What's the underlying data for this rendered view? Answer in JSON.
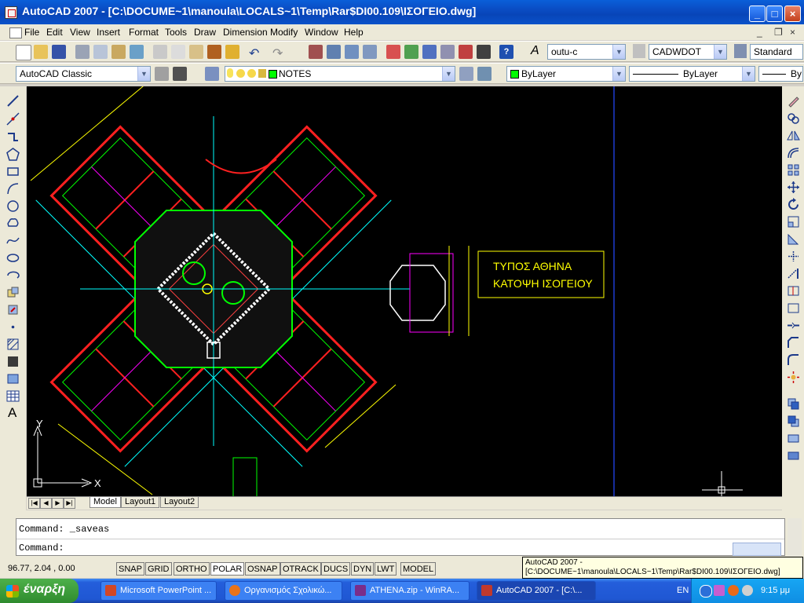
{
  "window": {
    "title": "AutoCAD 2007 - [C:\\DOCUME~1\\manoula\\LOCALS~1\\Temp\\Rar$DI00.109\\ΙΣΟΓΕΙΟ.dwg]",
    "min_glyph": "_",
    "max_glyph": "□",
    "close_glyph": "×"
  },
  "menu": [
    "File",
    "Edit",
    "View",
    "Insert",
    "Format",
    "Tools",
    "Draw",
    "Dimension",
    "Modify",
    "Window",
    "Help"
  ],
  "toolbar": {
    "text_style": "outu-c",
    "dim_style": "CADWDOT",
    "table_style": "Standard",
    "workspace": "AutoCAD Classic",
    "layer": "NOTES",
    "color": "ByLayer",
    "linetype": "ByLayer",
    "lineweight": "By"
  },
  "drawing": {
    "label_line1": "ΤΥΠΟΣ ΑΘΗΝΑ",
    "label_line2": "ΚΑΤΟΨΗ ΙΣΟΓΕΙΟΥ",
    "ucs_x": "X",
    "ucs_y": "Y"
  },
  "tabs": [
    "Model",
    "Layout1",
    "Layout2"
  ],
  "command": {
    "history": "Command: _saveas",
    "prompt": "Command:"
  },
  "status": {
    "coords": "96.77, 2.04 , 0.00",
    "buttons": [
      "SNAP",
      "GRID",
      "ORTHO",
      "POLAR",
      "OSNAP",
      "OTRACK",
      "DUCS",
      "DYN",
      "LWT",
      "MODEL"
    ]
  },
  "tooltip": {
    "line1": "AutoCAD 2007 -",
    "line2": "[C:\\DOCUME~1\\manoula\\LOCALS~1\\Temp\\Rar$DI00.109\\ΙΣΟΓΕΙΟ.dwg]"
  },
  "taskbar": {
    "start": "έναρξη",
    "tasks": [
      {
        "label": "Microsoft PowerPoint ...",
        "icon_color": "#d24726"
      },
      {
        "label": "Οργανισμός Σχολικώ...",
        "icon_color": "#e8731a"
      },
      {
        "label": "ATHENA.zip - WinRA...",
        "icon_color": "#7a2d8a"
      },
      {
        "label": "AutoCAD 2007 - [C:\\...",
        "icon_color": "#c0392b"
      }
    ],
    "lang": "EN",
    "clock": "9:15 μμ"
  }
}
